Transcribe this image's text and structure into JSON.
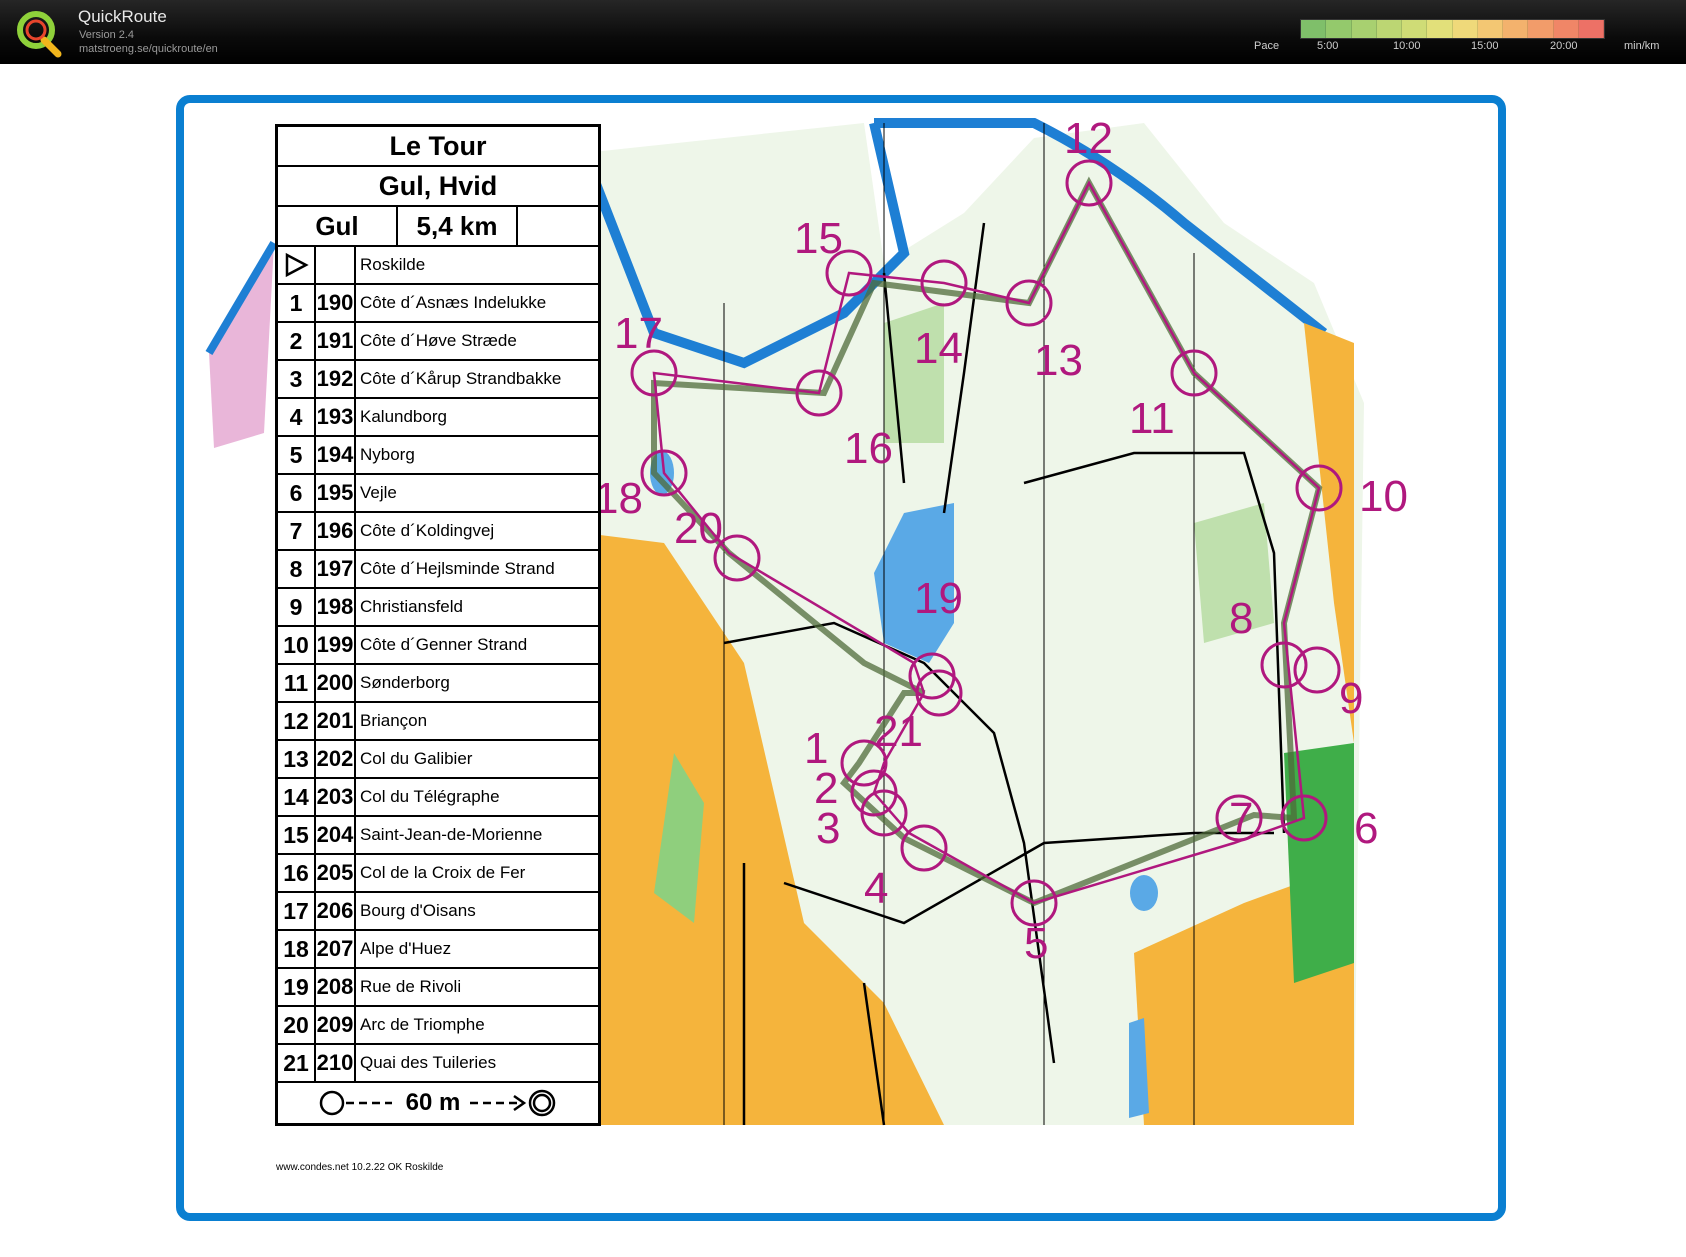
{
  "app": {
    "name": "QuickRoute",
    "version": "Version 2.4",
    "url": "matstroeng.se/quickroute/en"
  },
  "pace_scale": {
    "label": "Pace",
    "ticks": [
      "5:00",
      "10:00",
      "15:00",
      "20:00"
    ],
    "unit": "min/km",
    "colors": [
      "#7fbf6a",
      "#94c96c",
      "#a8d070",
      "#bcd673",
      "#cfdc76",
      "#e2e07a",
      "#efd97a",
      "#f3c773",
      "#f3b26d",
      "#f29c6a",
      "#f08667",
      "#ed7166"
    ]
  },
  "colors": {
    "frame": "#0a7fd1",
    "control": "#b0187e",
    "route": "#4f6b3a",
    "forest": "#cfe6c2",
    "open": "#f5b43c",
    "water": "#1e7fd4"
  },
  "course_sheet": {
    "title": "Le Tour",
    "classes": "Gul, Hvid",
    "class_name": "Gul",
    "length": "5,4 km",
    "start": "Roskilde",
    "controls": [
      {
        "num": "1",
        "code": "190",
        "desc": "Côte d´Asnæs Indelukke"
      },
      {
        "num": "2",
        "code": "191",
        "desc": "Côte d´Høve Stræde"
      },
      {
        "num": "3",
        "code": "192",
        "desc": "Côte d´Kårup Strandbakke"
      },
      {
        "num": "4",
        "code": "193",
        "desc": "Kalundborg"
      },
      {
        "num": "5",
        "code": "194",
        "desc": "Nyborg"
      },
      {
        "num": "6",
        "code": "195",
        "desc": "Vejle"
      },
      {
        "num": "7",
        "code": "196",
        "desc": "Côte d´Koldingvej"
      },
      {
        "num": "8",
        "code": "197",
        "desc": "Côte d´Hejlsminde Strand"
      },
      {
        "num": "9",
        "code": "198",
        "desc": "Christiansfeld"
      },
      {
        "num": "10",
        "code": "199",
        "desc": "Côte d´Genner Strand"
      },
      {
        "num": "11",
        "code": "200",
        "desc": "Sønderborg"
      },
      {
        "num": "12",
        "code": "201",
        "desc": "Briançon"
      },
      {
        "num": "13",
        "code": "202",
        "desc": "Col du Galibier"
      },
      {
        "num": "14",
        "code": "203",
        "desc": "Col du Télégraphe"
      },
      {
        "num": "15",
        "code": "204",
        "desc": "Saint-Jean-de-Morienne"
      },
      {
        "num": "16",
        "code": "205",
        "desc": "Col de la Croix de Fer"
      },
      {
        "num": "17",
        "code": "206",
        "desc": "Bourg d'Oisans"
      },
      {
        "num": "18",
        "code": "207",
        "desc": "Alpe d'Huez"
      },
      {
        "num": "19",
        "code": "208",
        "desc": "Rue de Rivoli"
      },
      {
        "num": "20",
        "code": "209",
        "desc": "Arc de Triomphe"
      },
      {
        "num": "21",
        "code": "210",
        "desc": "Quai des Tuileries"
      }
    ],
    "finish_distance": "60 m",
    "credit": "www.condes.net 10.2.22 OK Roskilde"
  },
  "map_controls": [
    {
      "label": "1"
    },
    {
      "label": "2"
    },
    {
      "label": "3"
    },
    {
      "label": "4"
    },
    {
      "label": "5"
    },
    {
      "label": "6"
    },
    {
      "label": "7"
    },
    {
      "label": "8"
    },
    {
      "label": "9"
    },
    {
      "label": "10"
    },
    {
      "label": "11"
    },
    {
      "label": "12"
    },
    {
      "label": "13"
    },
    {
      "label": "14"
    },
    {
      "label": "15"
    },
    {
      "label": "16"
    },
    {
      "label": "17"
    },
    {
      "label": "18"
    },
    {
      "label": "19"
    },
    {
      "label": "20"
    },
    {
      "label": "21"
    }
  ]
}
